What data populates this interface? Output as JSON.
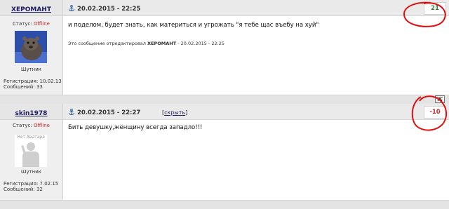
{
  "posts": [
    {
      "username": "ХЕРОМАНТ",
      "status_label": "Статус:",
      "status_value": "Offline",
      "rank": "Шутник",
      "reg_label": "Регистрация:",
      "reg_date": "10.02.13",
      "msgs_label": "Сообщений:",
      "msgs_count": "33",
      "date": "20.02.2015 - 22:25",
      "rating": "21",
      "message": "и поделом, будет знать, как материться и угрожать \"я тебе щас въебу на хуй\"",
      "edit_prefix": "Это сообщение отредактировал",
      "edit_user": "ХЕРОМАНТ",
      "edit_date": "- 20.02.2015 - 22:25"
    },
    {
      "username": "skin1978",
      "status_label": "Статус:",
      "status_value": "Offline",
      "avatar_text": "Нет Аватара",
      "rank": "Шутник",
      "reg_label": "Регистрация:",
      "reg_date": "7.02.15",
      "msgs_label": "Сообщений:",
      "msgs_count": "32",
      "date": "20.02.2015 - 22:27",
      "hide_open": "[",
      "hide_label": "скрыть",
      "hide_close": "]",
      "rating": "-10",
      "message": "Бить девушку,женщину всегда западло!!!"
    }
  ],
  "icons": {
    "anchor": "anchor-icon",
    "up": "arrow-up-icon"
  },
  "colors": {
    "positive": "#2e7d32",
    "negative": "#c62828",
    "annotation": "#e01010"
  }
}
